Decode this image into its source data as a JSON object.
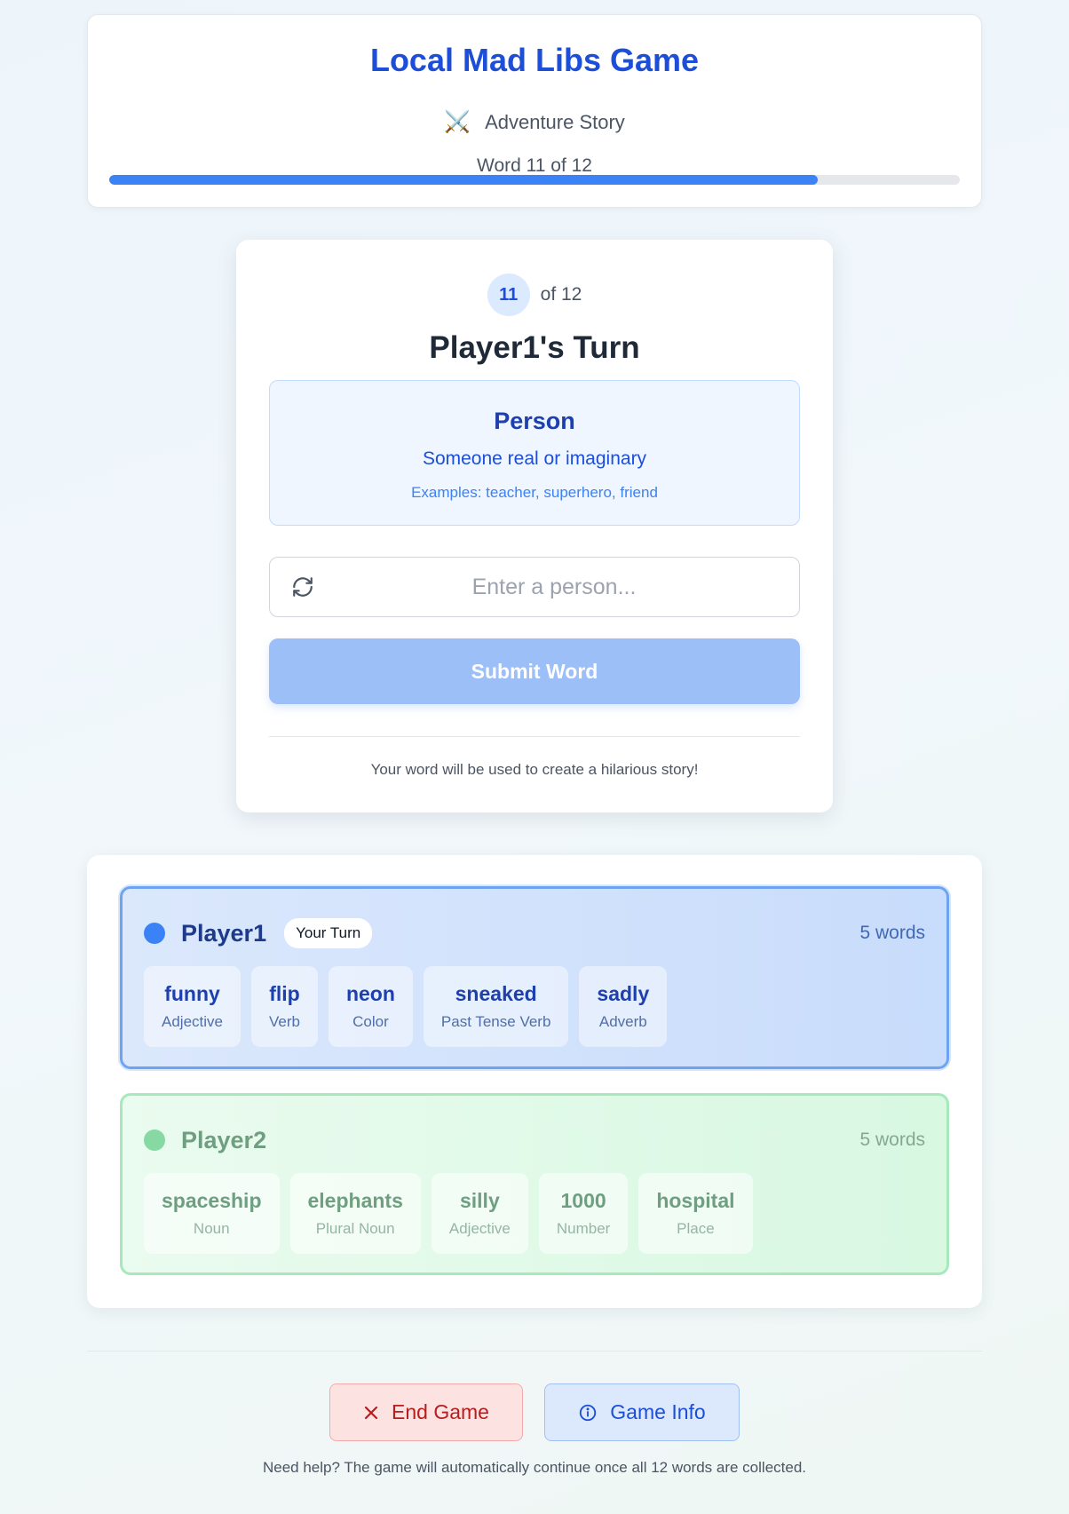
{
  "header": {
    "title": "Local Mad Libs Game",
    "story_icon": "⚔️",
    "story_type": "Adventure Story",
    "progress_text": "Word 11 of 12",
    "progress_fraction": 0.8333
  },
  "turn": {
    "current_number": "11",
    "of_total": "of 12",
    "title": "Player1's Turn",
    "prompt": {
      "word_type": "Person",
      "description": "Someone real or imaginary",
      "examples": "Examples: teacher, superhero, friend"
    },
    "input": {
      "placeholder": "Enter a person...",
      "value": ""
    },
    "submit_label": "Submit Word",
    "footer": "Your word will be used to create a hilarious story!"
  },
  "players": [
    {
      "name": "Player1",
      "badge": "Your Turn",
      "word_count": "5 words",
      "color": "#3b82f6",
      "words": [
        {
          "word": "funny",
          "type": "Adjective"
        },
        {
          "word": "flip",
          "type": "Verb"
        },
        {
          "word": "neon",
          "type": "Color"
        },
        {
          "word": "sneaked",
          "type": "Past Tense Verb"
        },
        {
          "word": "sadly",
          "type": "Adverb"
        }
      ]
    },
    {
      "name": "Player2",
      "word_count": "5 words",
      "color": "#86d9a2",
      "words": [
        {
          "word": "spaceship",
          "type": "Noun"
        },
        {
          "word": "elephants",
          "type": "Plural Noun"
        },
        {
          "word": "silly",
          "type": "Adjective"
        },
        {
          "word": "1000",
          "type": "Number"
        },
        {
          "word": "hospital",
          "type": "Place"
        }
      ]
    }
  ],
  "actions": {
    "end_label": "End Game",
    "info_label": "Game Info"
  },
  "help_text": "Need help? The game will automatically continue once all 12 words are collected."
}
